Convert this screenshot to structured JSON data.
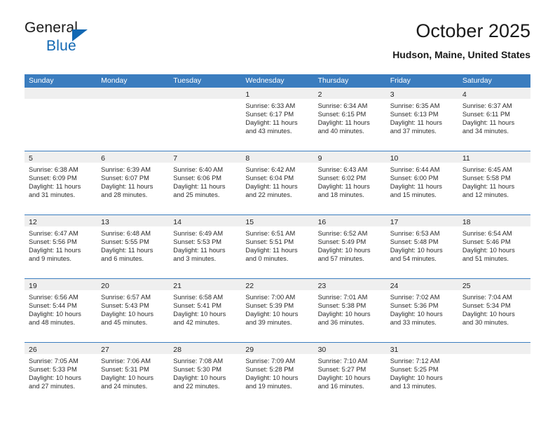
{
  "brand": {
    "name_top": "General",
    "name_bottom": "Blue",
    "accent_color": "#1268b3"
  },
  "header": {
    "title": "October 2025",
    "subtitle": "Hudson, Maine, United States"
  },
  "calendar": {
    "header_color": "#3b7dbf",
    "band_color": "#efefef",
    "day_names": [
      "Sunday",
      "Monday",
      "Tuesday",
      "Wednesday",
      "Thursday",
      "Friday",
      "Saturday"
    ],
    "labels": {
      "sunrise": "Sunrise:",
      "sunset": "Sunset:",
      "daylight": "Daylight:"
    },
    "weeks": [
      [
        {
          "day": "",
          "empty": true
        },
        {
          "day": "",
          "empty": true
        },
        {
          "day": "",
          "empty": true
        },
        {
          "day": "1",
          "sunrise": "Sunrise: 6:33 AM",
          "sunset": "Sunset: 6:17 PM",
          "daylight_l1": "Daylight: 11 hours",
          "daylight_l2": "and 43 minutes."
        },
        {
          "day": "2",
          "sunrise": "Sunrise: 6:34 AM",
          "sunset": "Sunset: 6:15 PM",
          "daylight_l1": "Daylight: 11 hours",
          "daylight_l2": "and 40 minutes."
        },
        {
          "day": "3",
          "sunrise": "Sunrise: 6:35 AM",
          "sunset": "Sunset: 6:13 PM",
          "daylight_l1": "Daylight: 11 hours",
          "daylight_l2": "and 37 minutes."
        },
        {
          "day": "4",
          "sunrise": "Sunrise: 6:37 AM",
          "sunset": "Sunset: 6:11 PM",
          "daylight_l1": "Daylight: 11 hours",
          "daylight_l2": "and 34 minutes."
        }
      ],
      [
        {
          "day": "5",
          "sunrise": "Sunrise: 6:38 AM",
          "sunset": "Sunset: 6:09 PM",
          "daylight_l1": "Daylight: 11 hours",
          "daylight_l2": "and 31 minutes."
        },
        {
          "day": "6",
          "sunrise": "Sunrise: 6:39 AM",
          "sunset": "Sunset: 6:07 PM",
          "daylight_l1": "Daylight: 11 hours",
          "daylight_l2": "and 28 minutes."
        },
        {
          "day": "7",
          "sunrise": "Sunrise: 6:40 AM",
          "sunset": "Sunset: 6:06 PM",
          "daylight_l1": "Daylight: 11 hours",
          "daylight_l2": "and 25 minutes."
        },
        {
          "day": "8",
          "sunrise": "Sunrise: 6:42 AM",
          "sunset": "Sunset: 6:04 PM",
          "daylight_l1": "Daylight: 11 hours",
          "daylight_l2": "and 22 minutes."
        },
        {
          "day": "9",
          "sunrise": "Sunrise: 6:43 AM",
          "sunset": "Sunset: 6:02 PM",
          "daylight_l1": "Daylight: 11 hours",
          "daylight_l2": "and 18 minutes."
        },
        {
          "day": "10",
          "sunrise": "Sunrise: 6:44 AM",
          "sunset": "Sunset: 6:00 PM",
          "daylight_l1": "Daylight: 11 hours",
          "daylight_l2": "and 15 minutes."
        },
        {
          "day": "11",
          "sunrise": "Sunrise: 6:45 AM",
          "sunset": "Sunset: 5:58 PM",
          "daylight_l1": "Daylight: 11 hours",
          "daylight_l2": "and 12 minutes."
        }
      ],
      [
        {
          "day": "12",
          "sunrise": "Sunrise: 6:47 AM",
          "sunset": "Sunset: 5:56 PM",
          "daylight_l1": "Daylight: 11 hours",
          "daylight_l2": "and 9 minutes."
        },
        {
          "day": "13",
          "sunrise": "Sunrise: 6:48 AM",
          "sunset": "Sunset: 5:55 PM",
          "daylight_l1": "Daylight: 11 hours",
          "daylight_l2": "and 6 minutes."
        },
        {
          "day": "14",
          "sunrise": "Sunrise: 6:49 AM",
          "sunset": "Sunset: 5:53 PM",
          "daylight_l1": "Daylight: 11 hours",
          "daylight_l2": "and 3 minutes."
        },
        {
          "day": "15",
          "sunrise": "Sunrise: 6:51 AM",
          "sunset": "Sunset: 5:51 PM",
          "daylight_l1": "Daylight: 11 hours",
          "daylight_l2": "and 0 minutes."
        },
        {
          "day": "16",
          "sunrise": "Sunrise: 6:52 AM",
          "sunset": "Sunset: 5:49 PM",
          "daylight_l1": "Daylight: 10 hours",
          "daylight_l2": "and 57 minutes."
        },
        {
          "day": "17",
          "sunrise": "Sunrise: 6:53 AM",
          "sunset": "Sunset: 5:48 PM",
          "daylight_l1": "Daylight: 10 hours",
          "daylight_l2": "and 54 minutes."
        },
        {
          "day": "18",
          "sunrise": "Sunrise: 6:54 AM",
          "sunset": "Sunset: 5:46 PM",
          "daylight_l1": "Daylight: 10 hours",
          "daylight_l2": "and 51 minutes."
        }
      ],
      [
        {
          "day": "19",
          "sunrise": "Sunrise: 6:56 AM",
          "sunset": "Sunset: 5:44 PM",
          "daylight_l1": "Daylight: 10 hours",
          "daylight_l2": "and 48 minutes."
        },
        {
          "day": "20",
          "sunrise": "Sunrise: 6:57 AM",
          "sunset": "Sunset: 5:43 PM",
          "daylight_l1": "Daylight: 10 hours",
          "daylight_l2": "and 45 minutes."
        },
        {
          "day": "21",
          "sunrise": "Sunrise: 6:58 AM",
          "sunset": "Sunset: 5:41 PM",
          "daylight_l1": "Daylight: 10 hours",
          "daylight_l2": "and 42 minutes."
        },
        {
          "day": "22",
          "sunrise": "Sunrise: 7:00 AM",
          "sunset": "Sunset: 5:39 PM",
          "daylight_l1": "Daylight: 10 hours",
          "daylight_l2": "and 39 minutes."
        },
        {
          "day": "23",
          "sunrise": "Sunrise: 7:01 AM",
          "sunset": "Sunset: 5:38 PM",
          "daylight_l1": "Daylight: 10 hours",
          "daylight_l2": "and 36 minutes."
        },
        {
          "day": "24",
          "sunrise": "Sunrise: 7:02 AM",
          "sunset": "Sunset: 5:36 PM",
          "daylight_l1": "Daylight: 10 hours",
          "daylight_l2": "and 33 minutes."
        },
        {
          "day": "25",
          "sunrise": "Sunrise: 7:04 AM",
          "sunset": "Sunset: 5:34 PM",
          "daylight_l1": "Daylight: 10 hours",
          "daylight_l2": "and 30 minutes."
        }
      ],
      [
        {
          "day": "26",
          "sunrise": "Sunrise: 7:05 AM",
          "sunset": "Sunset: 5:33 PM",
          "daylight_l1": "Daylight: 10 hours",
          "daylight_l2": "and 27 minutes."
        },
        {
          "day": "27",
          "sunrise": "Sunrise: 7:06 AM",
          "sunset": "Sunset: 5:31 PM",
          "daylight_l1": "Daylight: 10 hours",
          "daylight_l2": "and 24 minutes."
        },
        {
          "day": "28",
          "sunrise": "Sunrise: 7:08 AM",
          "sunset": "Sunset: 5:30 PM",
          "daylight_l1": "Daylight: 10 hours",
          "daylight_l2": "and 22 minutes."
        },
        {
          "day": "29",
          "sunrise": "Sunrise: 7:09 AM",
          "sunset": "Sunset: 5:28 PM",
          "daylight_l1": "Daylight: 10 hours",
          "daylight_l2": "and 19 minutes."
        },
        {
          "day": "30",
          "sunrise": "Sunrise: 7:10 AM",
          "sunset": "Sunset: 5:27 PM",
          "daylight_l1": "Daylight: 10 hours",
          "daylight_l2": "and 16 minutes."
        },
        {
          "day": "31",
          "sunrise": "Sunrise: 7:12 AM",
          "sunset": "Sunset: 5:25 PM",
          "daylight_l1": "Daylight: 10 hours",
          "daylight_l2": "and 13 minutes."
        },
        {
          "day": "",
          "empty": true
        }
      ]
    ]
  }
}
